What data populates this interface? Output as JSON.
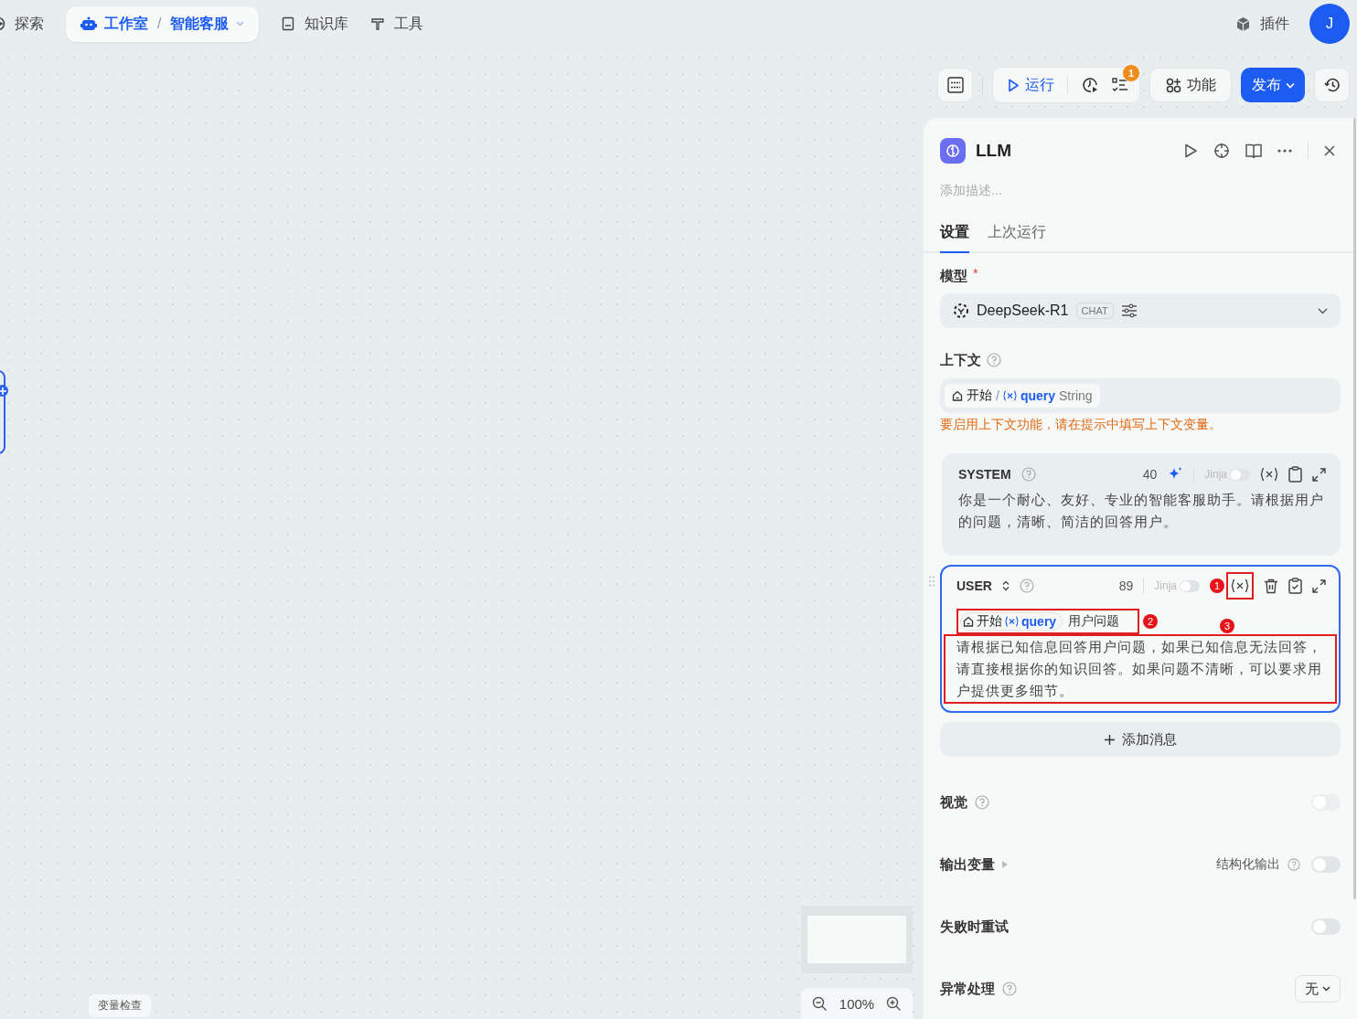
{
  "nav": {
    "items": [
      {
        "label": "探索",
        "kind": "link"
      },
      {
        "kind": "breadcrumb",
        "parts": [
          "工作室",
          "智能客服"
        ],
        "separator": "/"
      },
      {
        "label": "知识库",
        "kind": "book"
      },
      {
        "label": "工具",
        "kind": "tool"
      }
    ],
    "plugins": "插件",
    "avatar": "J"
  },
  "toolbar": {
    "run": "运行",
    "badge": "1",
    "features": "功能",
    "publish": "发布"
  },
  "panel": {
    "title": "LLM",
    "description_placeholder": "添加描述...",
    "tabs": [
      {
        "label": "设置",
        "selected": true
      },
      {
        "label": "上次运行",
        "selected": false
      }
    ],
    "model": {
      "label": "模型",
      "required_mark": "*",
      "name": "DeepSeek-R1",
      "tag": "CHAT"
    },
    "context": {
      "label": "上下文",
      "node": "开始",
      "separator": "/",
      "variable": "query",
      "type": "String",
      "warning": "要启用上下文功能，请在提示中填写上下文变量。"
    },
    "messages": [
      {
        "kind": "system",
        "role": "SYSTEM",
        "count": "40",
        "jinja": "Jinja",
        "jinja_on": false,
        "focused": false,
        "text": "你是一个耐心、友好、专业的智能客服助手。请根据用户的问题，清晰、简洁的回答用户。"
      },
      {
        "kind": "user",
        "role": "USER",
        "count": "89",
        "jinja": "Jinja",
        "jinja_on": false,
        "focused": true,
        "chip": {
          "node": "开始",
          "variable": "query",
          "label": "用户问题"
        },
        "text": "请根据已知信息回答用户问题，如果已知信息无法回答，请直接根据你的知识回答。如果问题不清晰，可以要求用户提供更多细节。"
      }
    ],
    "add_message": "添加消息",
    "settings": [
      {
        "kind": "toggle",
        "label": "视觉",
        "help": true,
        "on": false
      },
      {
        "kind": "output",
        "label": "输出变量",
        "right_label": "结构化输出",
        "on": false
      },
      {
        "kind": "toggle",
        "label": "失败时重试",
        "help": false,
        "on": false
      },
      {
        "kind": "select",
        "label": "异常处理",
        "help": true,
        "value": "无"
      }
    ]
  },
  "annotations": [
    {
      "number": "1"
    },
    {
      "number": "2"
    },
    {
      "number": "3"
    }
  ],
  "canvas": {
    "variable_check": "变量检查",
    "zoom": "100%"
  }
}
